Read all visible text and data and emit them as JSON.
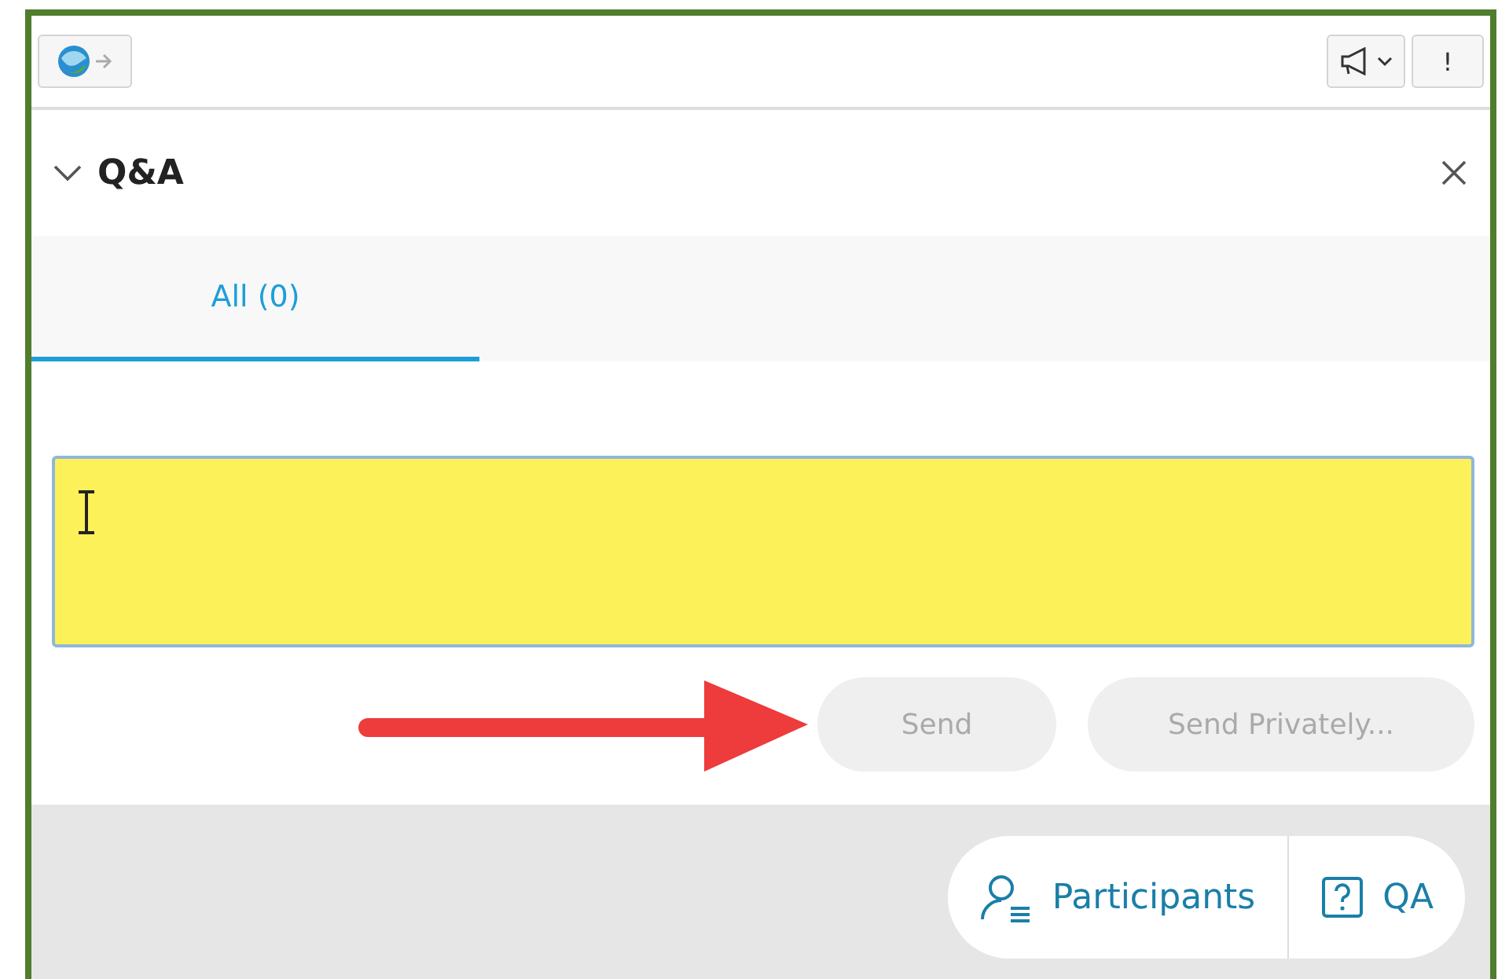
{
  "toolbar": {
    "alert_button": "!"
  },
  "panel": {
    "title": "Q&A",
    "expanded": true
  },
  "tabs": [
    {
      "label": "All (0)",
      "selected": true
    }
  ],
  "question_field": {
    "highlighted": true
  },
  "buttons": [
    {
      "label": "Send",
      "disabled": true
    },
    {
      "label": "Send Privately...",
      "disabled": true
    }
  ],
  "bottom_bar": [
    {
      "label": "Participants",
      "kind": "participants"
    },
    {
      "label": "QA",
      "kind": "qa"
    }
  ]
}
